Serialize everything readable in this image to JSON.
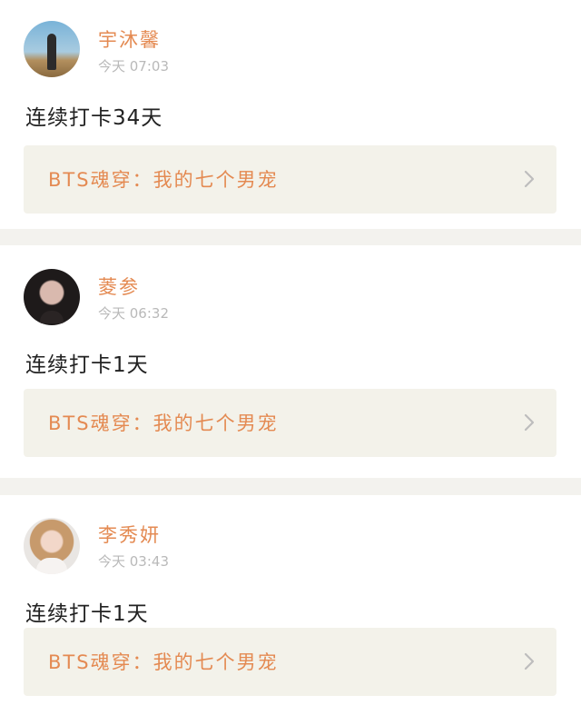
{
  "posts": [
    {
      "username": "宇沐馨",
      "time": "今天 07:03",
      "checkin_text": "连续打卡34天",
      "book_title": "BTS魂穿：我的七个男宠"
    },
    {
      "username": "菱参",
      "time": "今天 06:32",
      "checkin_text": "连续打卡1天",
      "book_title": "BTS魂穿：我的七个男宠"
    },
    {
      "username": "李秀妍",
      "time": "今天 03:43",
      "checkin_text": "连续打卡1天",
      "book_title": "BTS魂穿：我的七个男宠"
    }
  ],
  "colors": {
    "accent": "#e48a52",
    "muted": "#b9b9b9",
    "card_bg": "#f3f2ea",
    "separator": "#f3f2ee"
  },
  "icons": {
    "book_link": "chevron-right-icon"
  }
}
